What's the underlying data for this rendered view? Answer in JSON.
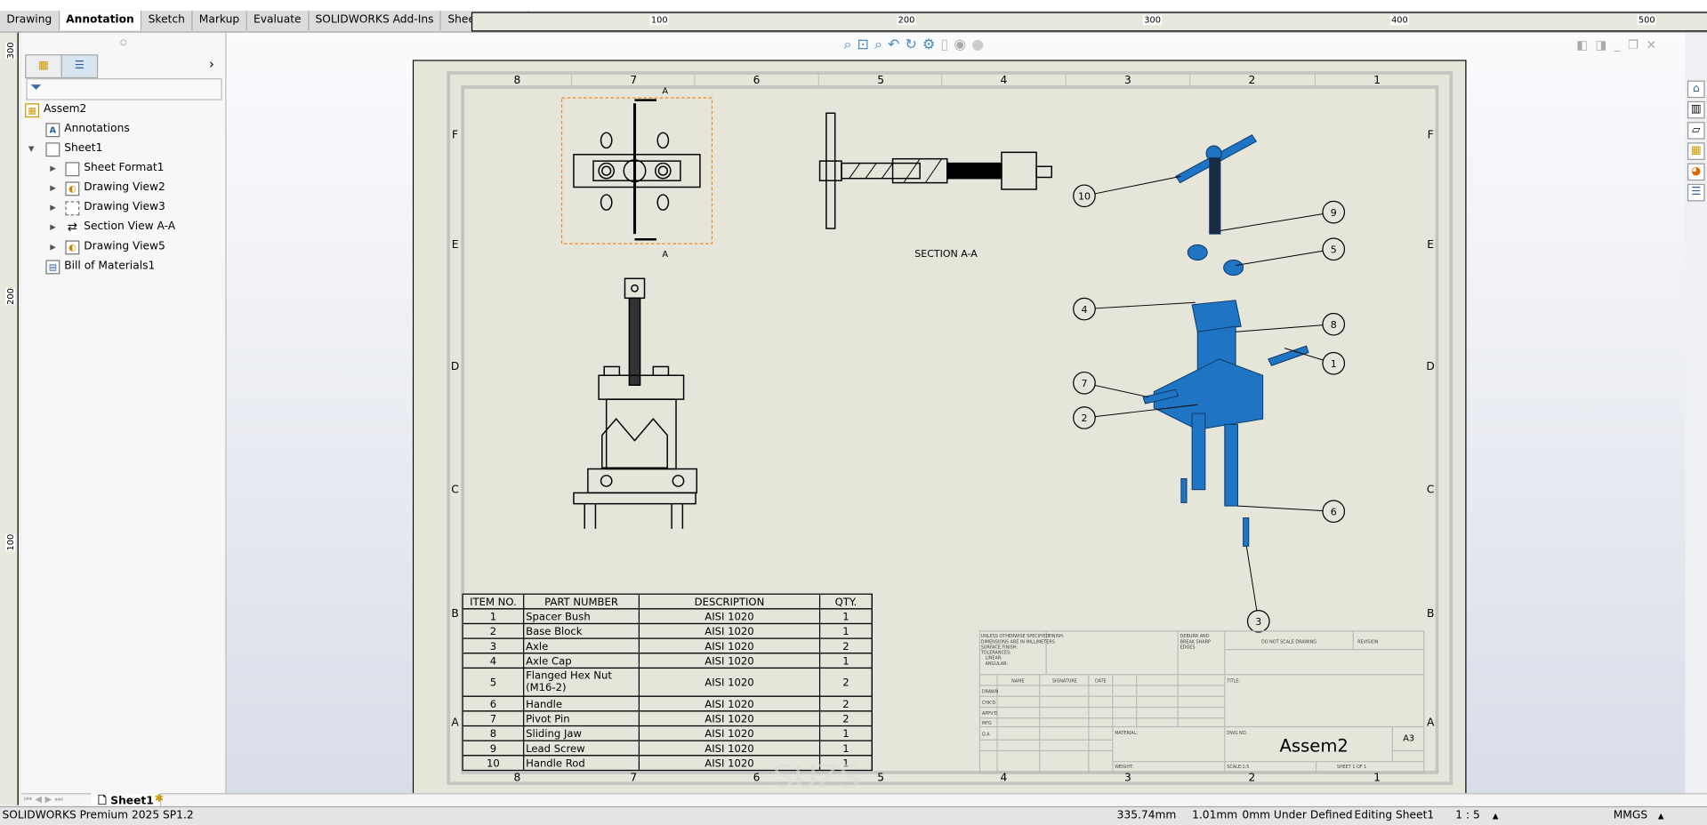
{
  "tabs": [
    {
      "label": "Drawing"
    },
    {
      "label": "Annotation",
      "active": true
    },
    {
      "label": "Sketch"
    },
    {
      "label": "Markup"
    },
    {
      "label": "Evaluate"
    },
    {
      "label": "SOLIDWORKS Add-Ins"
    },
    {
      "label": "Sheet Format"
    }
  ],
  "ruler": {
    "h_labels": [
      "100",
      "200",
      "300",
      "400",
      "500"
    ],
    "v_labels": [
      "300",
      "200",
      "100"
    ]
  },
  "tree": {
    "root": "Assem2",
    "items": [
      {
        "label": "Annotations"
      },
      {
        "label": "Sheet1"
      },
      {
        "label": "Sheet Format1"
      },
      {
        "label": "Drawing View2"
      },
      {
        "label": "Drawing View3"
      },
      {
        "label": "Section View A-A"
      },
      {
        "label": "Drawing View5"
      },
      {
        "label": "Bill of Materials1"
      }
    ]
  },
  "drawing": {
    "zone_numbers": [
      "8",
      "7",
      "6",
      "5",
      "4",
      "3",
      "2",
      "1"
    ],
    "zone_letters": [
      "F",
      "E",
      "D",
      "C",
      "B",
      "A"
    ],
    "section_label": "SECTION A-A",
    "section_marker": "A",
    "balloons": [
      "10",
      "9",
      "5",
      "4",
      "8",
      "1",
      "7",
      "2",
      "6",
      "3"
    ],
    "part_color": "#1f74c4",
    "selection_color": "#f08a24"
  },
  "bom": {
    "headers": [
      "ITEM NO.",
      "PART NUMBER",
      "DESCRIPTION",
      "QTY."
    ],
    "rows": [
      [
        "1",
        "Spacer Bush",
        "AISI 1020",
        "1"
      ],
      [
        "2",
        "Base Block",
        "AISI 1020",
        "1"
      ],
      [
        "3",
        "Axle",
        "AISI 1020",
        "2"
      ],
      [
        "4",
        "Axle Cap",
        "AISI 1020",
        "1"
      ],
      [
        "5",
        "Flanged Hex Nut (M16-2)",
        "AISI 1020",
        "2"
      ],
      [
        "6",
        "Handle",
        "AISI 1020",
        "2"
      ],
      [
        "7",
        "Pivot Pin",
        "AISI 1020",
        "2"
      ],
      [
        "8",
        "Sliding Jaw",
        "AISI 1020",
        "1"
      ],
      [
        "9",
        "Lead Screw",
        "AISI 1020",
        "1"
      ],
      [
        "10",
        "Handle Rod",
        "AISI 1020",
        "1"
      ]
    ]
  },
  "title_block": {
    "notes": [
      "UNLESS OTHERWISE SPECIFIED:",
      "DIMENSIONS ARE IN MILLIMETERS",
      "SURFACE FINISH:",
      "TOLERANCES:",
      "LINEAR:",
      "ANGULAR:"
    ],
    "finish": "FINISH:",
    "deburr": [
      "DEBURR AND",
      "BREAK SHARP",
      "EDGES"
    ],
    "do_not_scale": "DO NOT SCALE DRAWING",
    "revision": "REVISION",
    "col_headers": [
      "NAME",
      "SIGNATURE",
      "DATE"
    ],
    "row_labels": [
      "DRAWN",
      "CHK'D",
      "APPV'D",
      "MFG",
      "Q.A"
    ],
    "title": "TITLE:",
    "material": "MATERIAL:",
    "dwg_no": "DWG NO.",
    "dwg_name": "Assem2",
    "size": "A3",
    "weight": "WEIGHT:",
    "scale": "SCALE:1:5",
    "sheet": "SHEET 1 OF 1"
  },
  "sheet_tab": "Sheet1",
  "status": {
    "app": "SOLIDWORKS Premium 2025 SP1.2",
    "x": "335.74mm",
    "y": "1.01mm",
    "z": "0mm",
    "state": "Under Defined",
    "editing": "Editing Sheet1",
    "scale": "1 : 5",
    "units": "MMGS"
  }
}
